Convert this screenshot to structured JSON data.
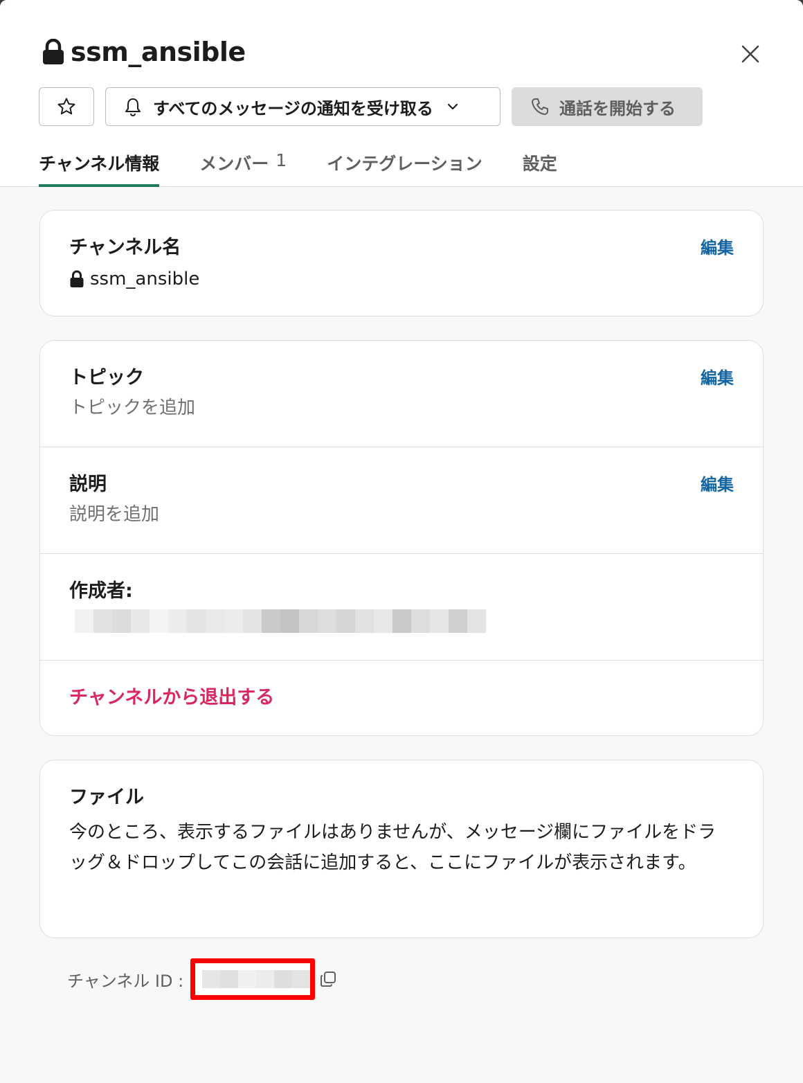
{
  "header": {
    "channel_name": "ssm_ansible",
    "notify_label": "すべてのメッセージの通知を受け取る",
    "call_label": "通話を開始する"
  },
  "tabs": [
    {
      "label": "チャンネル情報",
      "active": true
    },
    {
      "label": "メンバー",
      "count": "1"
    },
    {
      "label": "インテグレーション"
    },
    {
      "label": "設定"
    }
  ],
  "channel_card": {
    "title": "チャンネル名",
    "value": "ssm_ansible",
    "edit_label": "編集"
  },
  "topic": {
    "title": "トピック",
    "placeholder": "トピックを追加",
    "edit_label": "編集"
  },
  "description": {
    "title": "説明",
    "placeholder": "説明を追加",
    "edit_label": "編集"
  },
  "creator": {
    "title": "作成者:"
  },
  "leave_label": "チャンネルから退出する",
  "files": {
    "title": "ファイル",
    "empty_text": "今のところ、表示するファイルはありませんが、メッセージ欄にファイルをドラッグ＆ドロップしてこの会話に追加すると、ここにファイルが表示されます。"
  },
  "channel_id": {
    "label": "チャンネル ID :"
  },
  "colors": {
    "accent_tab": "#1f7a5c",
    "link": "#1264a3",
    "danger": "#d9285f",
    "highlight": "#ff0000"
  }
}
